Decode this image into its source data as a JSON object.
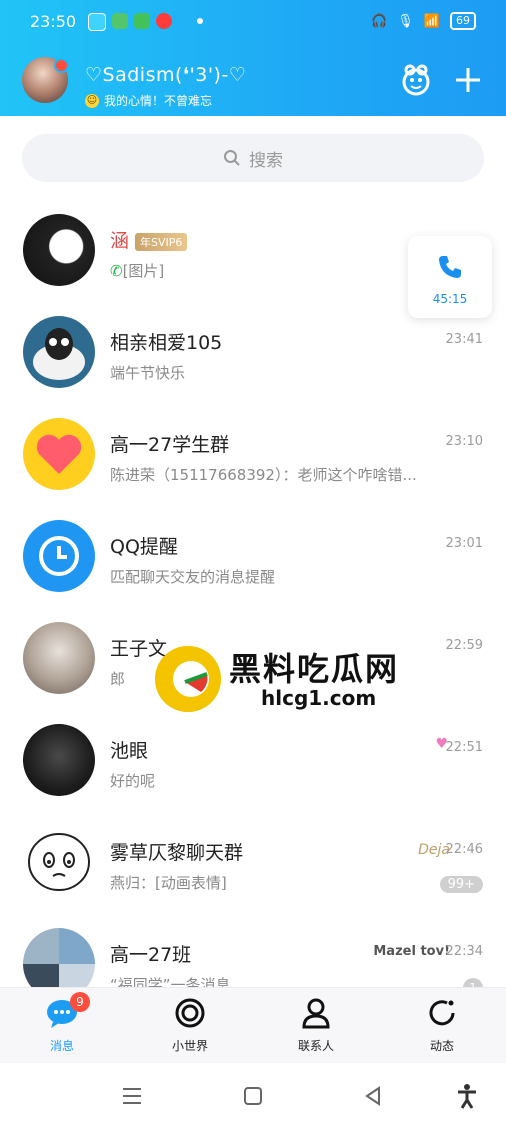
{
  "status_bar": {
    "time": "23:50",
    "battery": "69"
  },
  "header": {
    "nickname": "♡Sadism(❛'3')-♡",
    "signature": "我的心情！不曾难忘"
  },
  "search": {
    "placeholder": "搜索"
  },
  "call_bubble": {
    "duration": "45:15"
  },
  "conversations": [
    {
      "name": "涵",
      "vip": "年SVIP6",
      "message": "[图片]",
      "time": "",
      "badge": ""
    },
    {
      "name": "相亲相爱105",
      "message": "端午节快乐",
      "time": "23:41",
      "badge": ""
    },
    {
      "name": "高一27学生群",
      "message": "陈进荣（15117668392）：老师这个咋啥错...",
      "time": "23:10",
      "badge": ""
    },
    {
      "name": "QQ提醒",
      "message": "匹配聊天交友的消息提醒",
      "time": "23:01",
      "badge": ""
    },
    {
      "name": "王子文",
      "message": "郎",
      "time": "22:59",
      "badge": ""
    },
    {
      "name": "池眼",
      "message": "好的呢",
      "time": "22:51",
      "badge": ""
    },
    {
      "name": "雾草仄黎聊天群",
      "message": "燕归：[动画表情]",
      "time": "22:46",
      "badge": "99+",
      "deco": "Deja"
    },
    {
      "name": "高一27班",
      "message": "“福同学”一条消息",
      "time": "22:34",
      "badge": "1",
      "deco": "Mazel tov!"
    }
  ],
  "watermark": {
    "title": "黑料吃瓜网",
    "url": "hlcg1.com"
  },
  "tabbar": {
    "tabs": [
      {
        "label": "消息",
        "badge": "9"
      },
      {
        "label": "小世界"
      },
      {
        "label": "联系人"
      },
      {
        "label": "动态"
      }
    ]
  },
  "colors": {
    "accent": "#1d9cf3",
    "header_gradient_start": "#21c4f6",
    "badge_red": "#ff4d3d"
  }
}
